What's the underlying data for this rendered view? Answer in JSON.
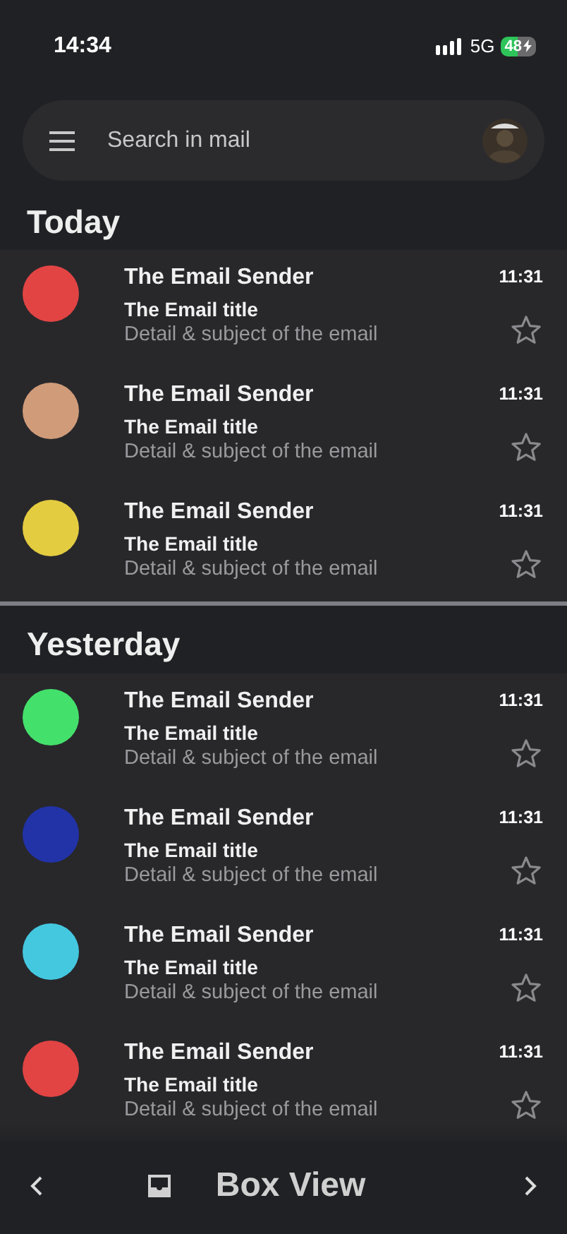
{
  "status_bar": {
    "time": "14:34",
    "network": "5G",
    "battery": "48"
  },
  "search": {
    "placeholder": "Search in mail"
  },
  "sections": [
    {
      "title": "Today",
      "emails": [
        {
          "sender": "The Email Sender",
          "time": "11:31",
          "title": "The Email title",
          "detail": "Detail & subject of the email",
          "color": "#e24444",
          "starred": false
        },
        {
          "sender": "The Email Sender",
          "time": "11:31",
          "title": "The Email title",
          "detail": "Detail & subject of the email",
          "color": "#d09b78",
          "starred": false
        },
        {
          "sender": "The Email Sender",
          "time": "11:31",
          "title": "The Email title",
          "detail": "Detail & subject of the email",
          "color": "#e3cc40",
          "starred": false
        }
      ]
    },
    {
      "title": "Yesterday",
      "emails": [
        {
          "sender": "The Email Sender",
          "time": "11:31",
          "title": "The Email title",
          "detail": "Detail & subject of the email",
          "color": "#44e06c",
          "starred": false
        },
        {
          "sender": "The Email Sender",
          "time": "11:31",
          "title": "The Email title",
          "detail": "Detail & subject of the email",
          "color": "#2233a8",
          "starred": false
        },
        {
          "sender": "The Email Sender",
          "time": "11:31",
          "title": "The Email title",
          "detail": "Detail & subject of the email",
          "color": "#44c8e0",
          "starred": false
        },
        {
          "sender": "The Email Sender",
          "time": "11:31",
          "title": "The Email title",
          "detail": "Detail & subject of the email",
          "color": "#e24444",
          "starred": false
        }
      ]
    }
  ],
  "bottom_nav": {
    "label": "Box View"
  }
}
